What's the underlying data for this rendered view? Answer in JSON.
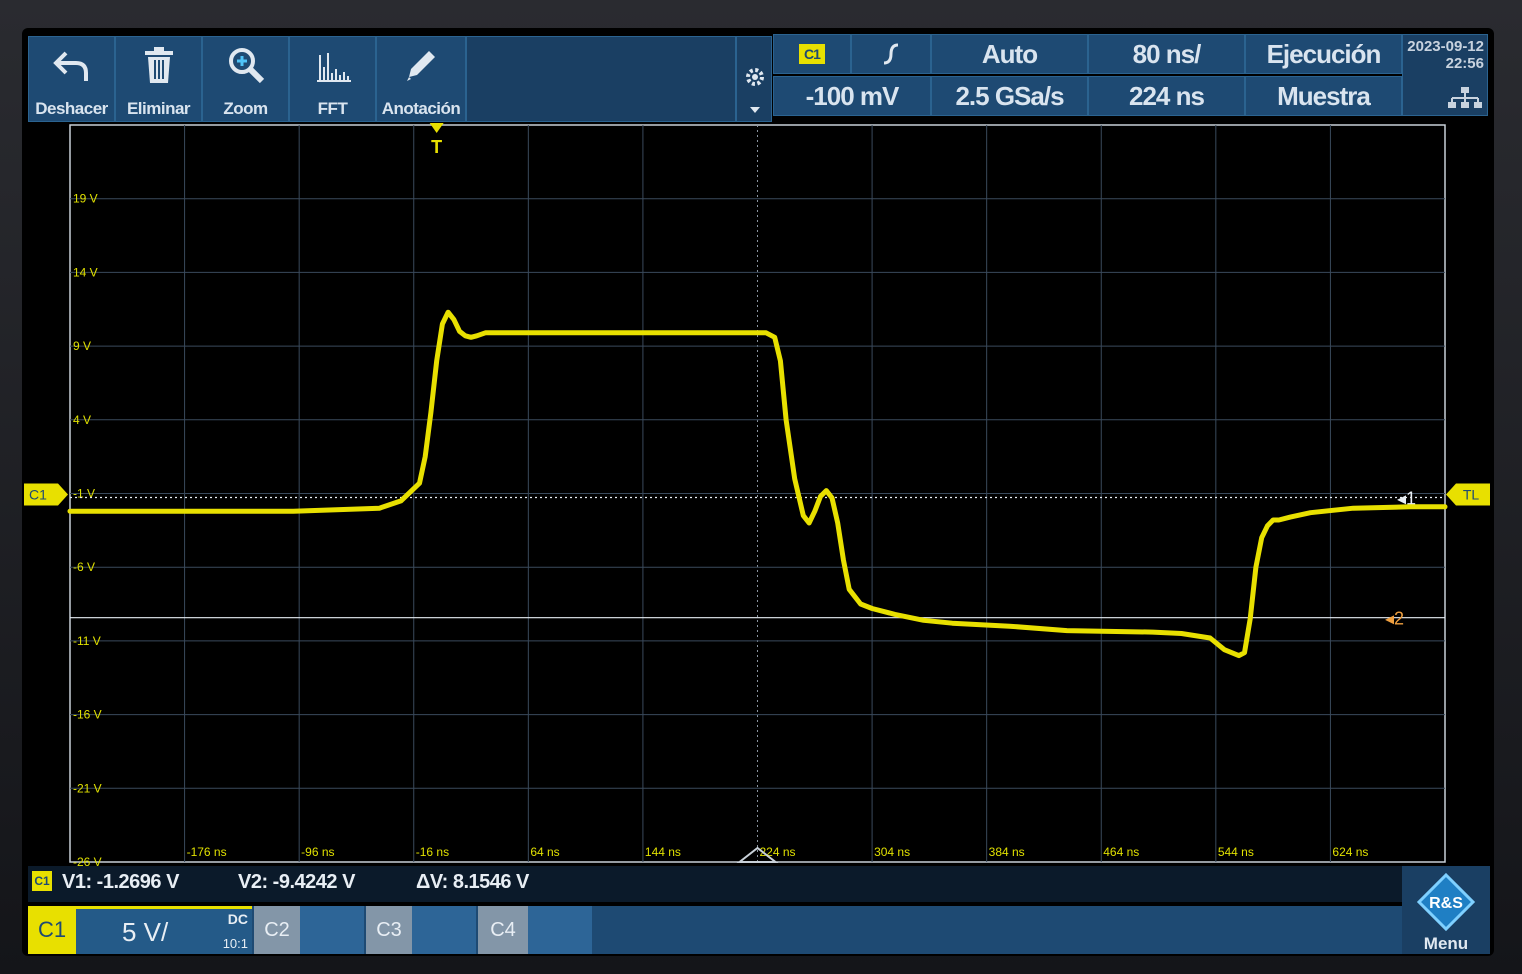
{
  "toolbar": {
    "buttons": [
      {
        "label": "Deshacer",
        "icon": "undo-icon"
      },
      {
        "label": "Eliminar",
        "icon": "trash-icon"
      },
      {
        "label": "Zoom",
        "icon": "zoom-icon"
      },
      {
        "label": "FFT",
        "icon": "fft-icon"
      },
      {
        "label": "Anotación",
        "icon": "pencil-icon"
      }
    ]
  },
  "trigger": {
    "source": "C1",
    "slope_icon": "rising-edge-icon",
    "level": "-100 mV",
    "mode": "Auto",
    "sample_rate": "2.5 GSa/s",
    "timebase": "80 ns/",
    "position": "224 ns",
    "run_state": "Ejecución",
    "acq_mode": "Muestra"
  },
  "timestamp": {
    "date": "2023-09-12",
    "time": "22:56"
  },
  "markers": {
    "trigger_time": "T",
    "channel_ref": "C1",
    "trigger_level": "TL",
    "cursor1": "1",
    "cursor2": "2"
  },
  "chart_data": {
    "type": "line",
    "ylabels": [
      "19 V",
      "14 V",
      "9 V",
      "4 V",
      "-1 V",
      "-6 V",
      "-11 V",
      "-16 V",
      "-21 V",
      "-26 V"
    ],
    "xlabels": [
      "-176 ns",
      "-96 ns",
      "-16 ns",
      "64 ns",
      "144 ns",
      "224 ns",
      "304 ns",
      "384 ns",
      "464 ns",
      "544 ns",
      "624 ns"
    ],
    "xlim": [
      -256,
      704
    ],
    "ylim": [
      -26,
      24
    ],
    "grid": true,
    "color": "#e8e000",
    "series": [
      {
        "x": [
          -256,
          -100,
          -40,
          -25,
          -12,
          -8,
          -4,
          0,
          4,
          8,
          12,
          16,
          20,
          24,
          28,
          34,
          40,
          44,
          48,
          60,
          80,
          120,
          160,
          200,
          230,
          236,
          240,
          244,
          250,
          256,
          260,
          264,
          268,
          272,
          276,
          280,
          284,
          288,
          296,
          304,
          320,
          340,
          360,
          400,
          440,
          500,
          520,
          540,
          550,
          560,
          564,
          568,
          572,
          576,
          580,
          584,
          588,
          596,
          610,
          640,
          680,
          704
        ],
        "y": [
          -2.2,
          -2.2,
          -2.0,
          -1.5,
          -0.3,
          1.5,
          4.5,
          8.0,
          10.5,
          11.3,
          10.8,
          10.0,
          9.7,
          9.6,
          9.7,
          9.9,
          9.9,
          9.9,
          9.9,
          9.9,
          9.9,
          9.9,
          9.9,
          9.9,
          9.9,
          9.6,
          8.0,
          4.0,
          0.0,
          -2.5,
          -3.0,
          -2.2,
          -1.2,
          -0.8,
          -1.3,
          -3.0,
          -5.5,
          -7.5,
          -8.5,
          -8.8,
          -9.2,
          -9.6,
          -9.8,
          -10.0,
          -10.3,
          -10.4,
          -10.5,
          -10.8,
          -11.6,
          -12.0,
          -11.8,
          -9.5,
          -6.0,
          -4.0,
          -3.2,
          -2.8,
          -2.8,
          -2.6,
          -2.3,
          -2.0,
          -1.9,
          -1.9
        ]
      }
    ],
    "cursor_levels": [
      -1.2696,
      -9.4242
    ]
  },
  "measurements": {
    "channel": "C1",
    "v1": "V1: -1.2696 V",
    "v2": "V2: -9.4242 V",
    "dv": "ΔV: 8.1546 V"
  },
  "channels": {
    "c1": {
      "name": "C1",
      "scale": "5 V/",
      "coupling": "DC",
      "probe": "10:1"
    },
    "c2": {
      "name": "C2"
    },
    "c3": {
      "name": "C3"
    },
    "c4": {
      "name": "C4"
    }
  },
  "menu": {
    "label": "Menu",
    "logo": "rs-logo-icon"
  }
}
